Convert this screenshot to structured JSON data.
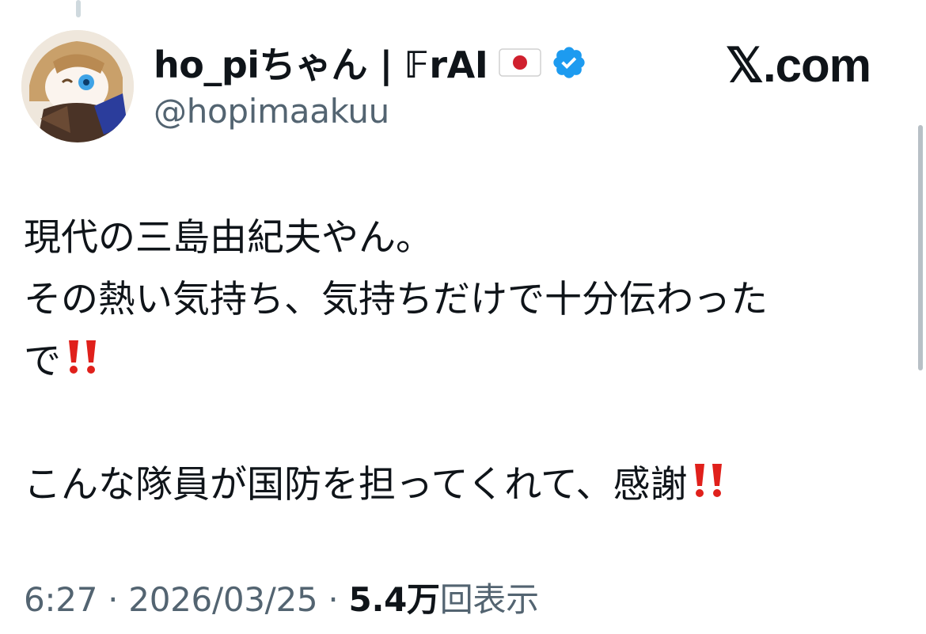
{
  "author": {
    "display_name": "ho_piちゃん | 𝔽rAI",
    "handle": "@hopimaakuu",
    "flag_icon": "japan-flag-icon",
    "verified_icon": "verified-badge-icon",
    "verified_color": "#1d9bf0"
  },
  "site": {
    "label": "𝕏.com"
  },
  "tweet": {
    "lines": [
      "現代の三島由紀夫やん。",
      "その熱い気持ち、気持ちだけで十分伝わった",
      "で",
      "こんな隊員が国防を担ってくれて、感謝"
    ],
    "emphasis_icon": "double-exclamation-icon",
    "emphasis_color": "#e0201b"
  },
  "meta": {
    "time": "6:27",
    "separator": " · ",
    "date": "2026/03/25",
    "views_count": "5.4万",
    "views_label": "回表示"
  },
  "colors": {
    "text": "#0f1419",
    "secondary": "#536471"
  }
}
